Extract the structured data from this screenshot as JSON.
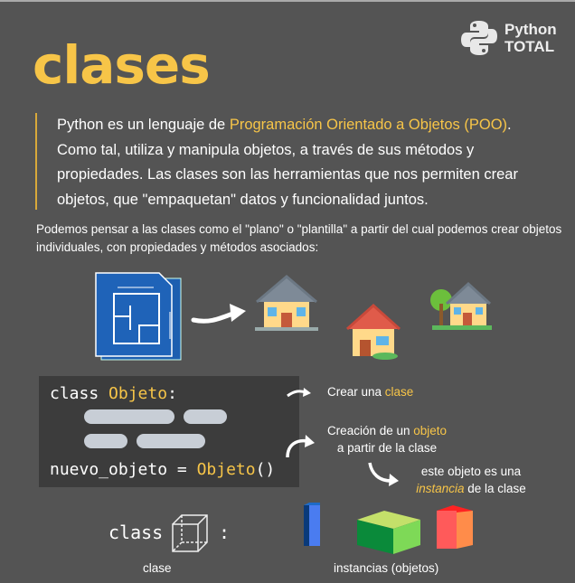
{
  "title": "clases",
  "logo": {
    "line1": "Python",
    "line2": "TOTAL"
  },
  "intro": {
    "before": "Python es un lenguaje de ",
    "highlight": "Programación Orientado a Objetos (POO)",
    "after": ". Como tal, utiliza y manipula objetos, a través de sus métodos y propiedades. Las clases son las herramientas que nos permiten crear objetos, que \"empaquetan\" datos y funcionalidad juntos."
  },
  "subtitle": "Podemos pensar a las clases como el \"plano\" o \"plantilla\" a partir del cual podemos crear objetos individuales, con propiedades y métodos asociados:",
  "code": {
    "kw": "class",
    "name": "Objeto",
    "colon": ":",
    "var": "nuevo_objeto = ",
    "call": "Objeto",
    "parens": "()"
  },
  "notes": {
    "create_class_prefix": "Crear una ",
    "create_class_hl": "clase",
    "create_obj_prefix": "Creación de un ",
    "create_obj_hl": "objeto",
    "create_obj_line2": "a partir de la clase",
    "instance_line1": "este objeto es una",
    "instance_hl": "instancia",
    "instance_rest": " de la clase"
  },
  "bottom": {
    "kw": "class",
    "colon": ":",
    "clase_label": "clase",
    "instances_label": "instancias (objetos)"
  },
  "colors": {
    "accent": "#f7c548",
    "background": "#545454",
    "code_bg": "#3c3c3c"
  }
}
